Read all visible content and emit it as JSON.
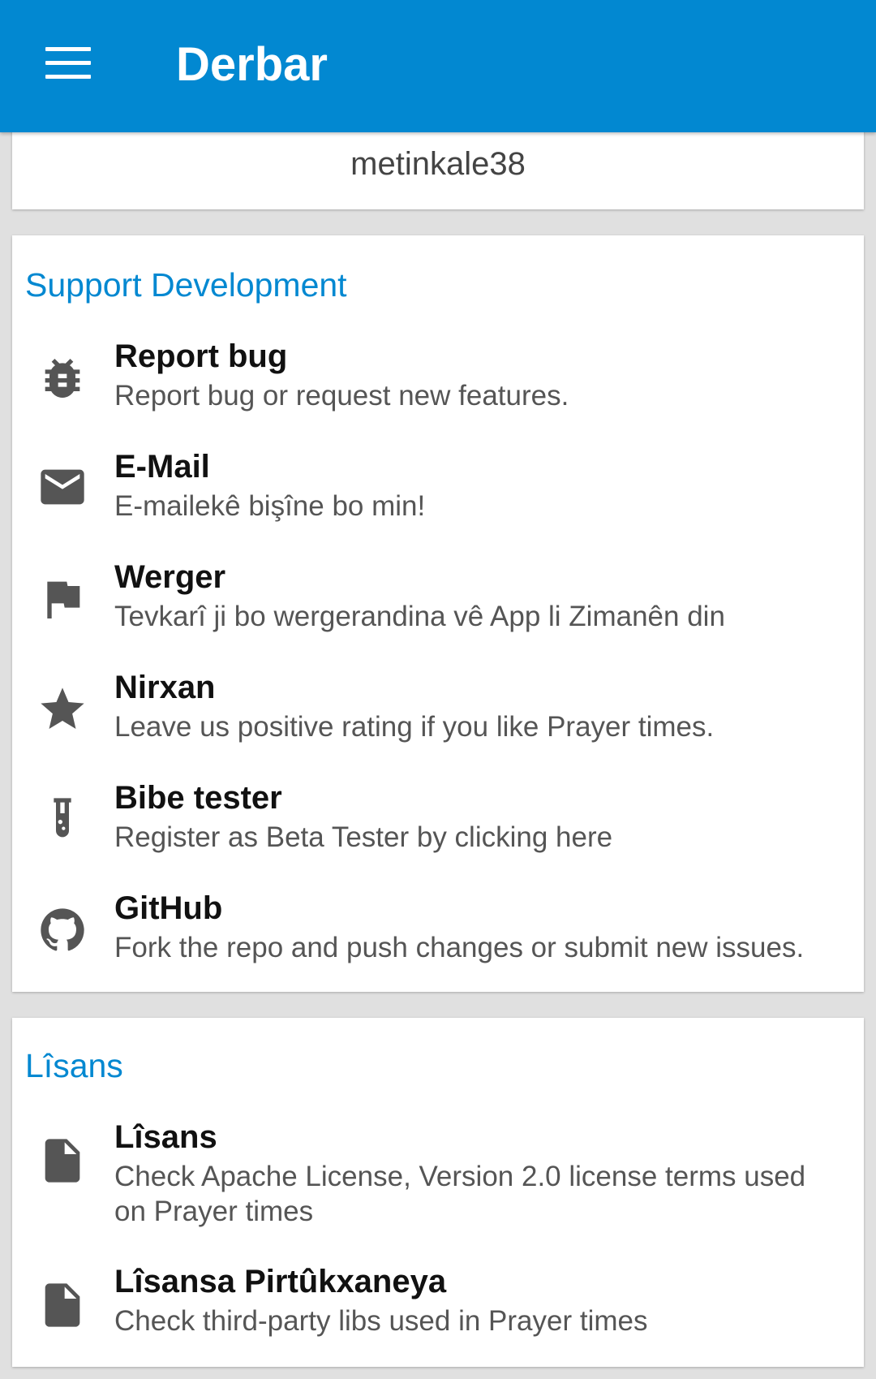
{
  "app_bar": {
    "title": "Derbar",
    "menu_icon": "hamburger-menu-icon",
    "color": "#0288d1"
  },
  "author_card": {
    "username": "metinkale38"
  },
  "support_section": {
    "header": "Support Development",
    "items": [
      {
        "title": "Report bug",
        "summary": "Report bug or request new features.",
        "icon": "bug-icon"
      },
      {
        "title": "E-Mail",
        "summary": "E-mailekê bişîne bo min!",
        "icon": "email-icon"
      },
      {
        "title": "Werger",
        "summary": "Tevkarî ji bo wergerandina vê App li Zimanên din",
        "icon": "flag-icon"
      },
      {
        "title": "Nirxan",
        "summary": "Leave us positive rating if you like Prayer times.",
        "icon": "star-icon"
      },
      {
        "title": "Bibe tester",
        "summary": "Register as Beta Tester by clicking here",
        "icon": "test-tube-icon"
      },
      {
        "title": "GitHub",
        "summary": "Fork the repo and push changes or submit new issues.",
        "icon": "github-icon"
      }
    ]
  },
  "license_section": {
    "header": "Lîsans",
    "items": [
      {
        "title": "Lîsans",
        "summary": "Check Apache License, Version 2.0 license terms used on Prayer times",
        "icon": "document-icon"
      },
      {
        "title": "Lîsansa Pirtûkxaneya",
        "summary": "Check third-party libs used in Prayer times",
        "icon": "document-icon"
      }
    ]
  },
  "colors": {
    "accent": "#0288d1",
    "icon": "#555555",
    "background": "#e0e0e0"
  }
}
